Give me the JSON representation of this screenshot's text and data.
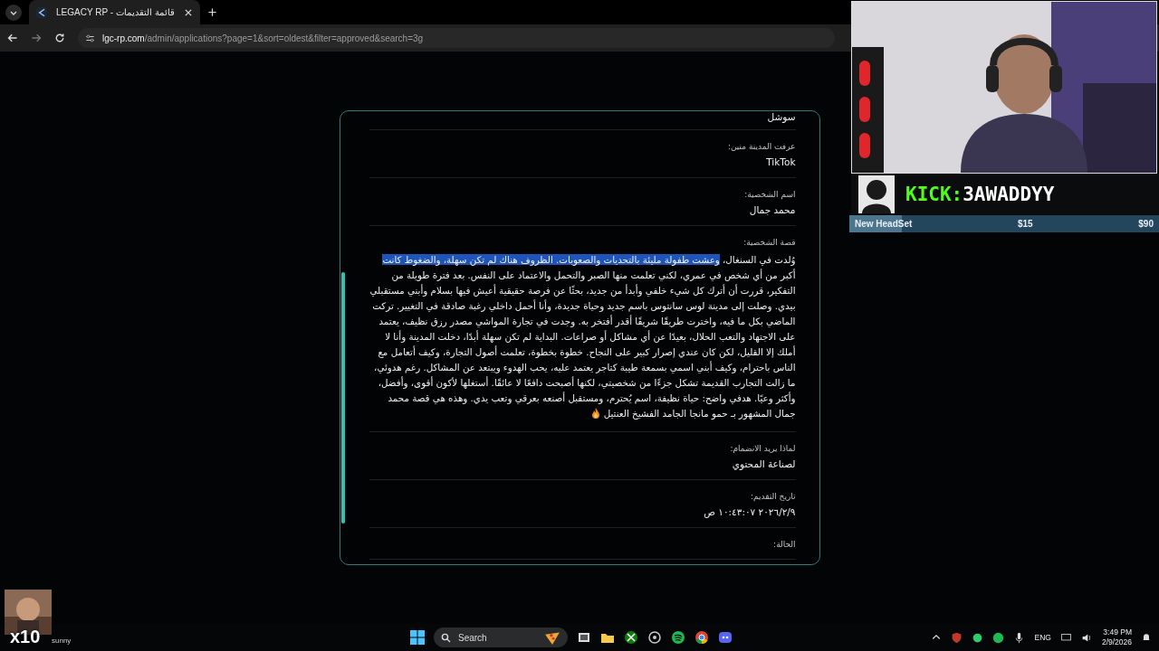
{
  "browser": {
    "tabs": [
      {
        "title": "LEGACY RP - قائمة التقديمات",
        "selected": true
      }
    ],
    "url_domain": "lgc-rp.com",
    "url_path": "/admin/applications?page=1&sort=oldest&filter=approved&search=3g"
  },
  "modal": {
    "fields": [
      {
        "kind": "text",
        "value": "سوشل"
      },
      {
        "kind": "text",
        "label": "عرفت المدينة منين:",
        "value": "TikTok"
      },
      {
        "kind": "text",
        "label": "اسم الشخصية:",
        "value": "محمد جمال"
      },
      {
        "kind": "story",
        "label": "قصة الشخصية:",
        "lines": [
          [
            {
              "text": "وُلدت في السنغال، ",
              "selected": false
            },
            {
              "text": "وعشت طفولة مليئة بالتحديات والصعوبات. الظروف هناك لم تكن سهلة، والضغوط كانت",
              "selected": true
            }
          ],
          [
            {
              "text": "أكبر من أي شخص في عمري، لكني تعلمت منها الصبر والتحمل والاعتماد على النفس. بعد فترة طويلة من",
              "selected": false
            }
          ],
          [
            {
              "text": "التفكير، قررت أن أترك كل شيء خلفي وأبدأ من جديد، بحثًا عن فرصة حقيقية أعيش فيها بسلام وأبني مستقبلي",
              "selected": false
            }
          ],
          [
            {
              "text": "بيدي. وصلت إلى مدينة لوس سانتوس باسم جديد وحياة جديدة، وأنا أحمل داخلي رغبة صادقة في التغيير. تركت",
              "selected": false
            }
          ],
          [
            {
              "text": "الماضي بكل ما فيه، واخترت طريقًا شريفًا أقدر أفتخر به. وجدت في تجارة المواشي مصدر رزق نظيف، يعتمد",
              "selected": false
            }
          ],
          [
            {
              "text": "على الاجتهاد والتعب الحلال، بعيدًا عن أي مشاكل أو صراعات. البداية لم تكن سهلة أبدًا، دخلت المدينة وأنا لا",
              "selected": false
            }
          ],
          [
            {
              "text": "أملك إلا القليل، لكن كان عندي إصرار كبير على النجاح. خطوة بخطوة، تعلمت أصول التجارة، وكيف أتعامل مع",
              "selected": false
            }
          ],
          [
            {
              "text": "الناس باحترام، وكيف أبني اسمي بسمعة طيبة كتاجر يعتمد عليه، يحب الهدوء ويبتعد عن المشاكل. رغم هدوئي،",
              "selected": false
            }
          ],
          [
            {
              "text": "ما زالت التجارب القديمة تشكل جزءًا من شخصيتي، لكنها أصبحت دافعًا لا عائقًا. أستغلها لأكون أقوى، وأفضل،",
              "selected": false
            }
          ],
          [
            {
              "text": "وأكثر وعيًا. هدفي واضح: حياة نظيفة، اسم يُحترم، ومستقبل أصنعه بعرقي وتعب يدي. وهذه هي قصة محمد",
              "selected": false
            }
          ],
          [
            {
              "text": "جمال المشهور بـ حمو مانجا الجامد الفشيخ العنتيل",
              "selected": false
            }
          ]
        ]
      },
      {
        "kind": "text",
        "label": "لماذا يريد الانضمام:",
        "value": "لصناعة المحتوي"
      },
      {
        "kind": "text",
        "label": "تاريخ التقديم:",
        "value": "٩‏/٢‏/٢٠٢٦ ١٠:٤٣:٠٧ ص"
      },
      {
        "kind": "text",
        "label": "الحالة:"
      }
    ]
  },
  "overlay": {
    "kick_prefix": "KICK:",
    "kick_handle": "3AWADDYY",
    "goal": {
      "name": "New HeadSet",
      "current": "$15",
      "target": "$90",
      "level": 0.17
    }
  },
  "emote": {
    "count": "x10",
    "caption": "sunny"
  },
  "taskbar": {
    "search": "Search",
    "language": "ENG",
    "time": "3:49 PM",
    "date": "2/9/2026"
  }
}
